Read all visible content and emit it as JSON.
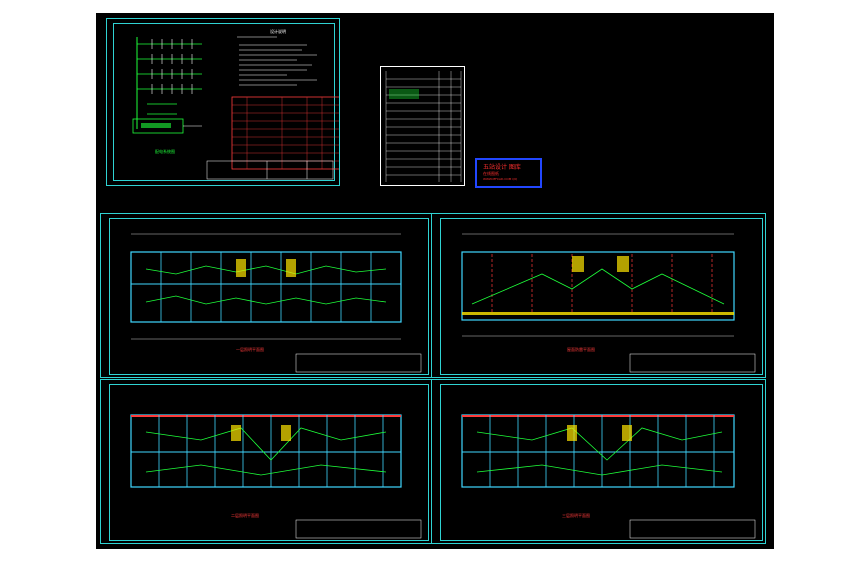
{
  "drawing": {
    "notes_title": "设计说明",
    "system_caption": "配电系统图",
    "stamp_title": "五站设计 图库",
    "stamp_line2": "在线图纸",
    "stamp_line3": "WWW.MFCAD.COM  QQ",
    "plan_captions": [
      "一层照明平面图",
      "屋面防雷平面图",
      "二层照明平面图",
      "三层照明平面图"
    ]
  },
  "colors": {
    "background": "#000000",
    "frame": "#2fd3d3",
    "wall": "#3fd7ff",
    "circuit": "#1eff3a",
    "text_red": "#ff3b3b",
    "dim": "#ffffff",
    "stamp_border": "#2247ff"
  }
}
